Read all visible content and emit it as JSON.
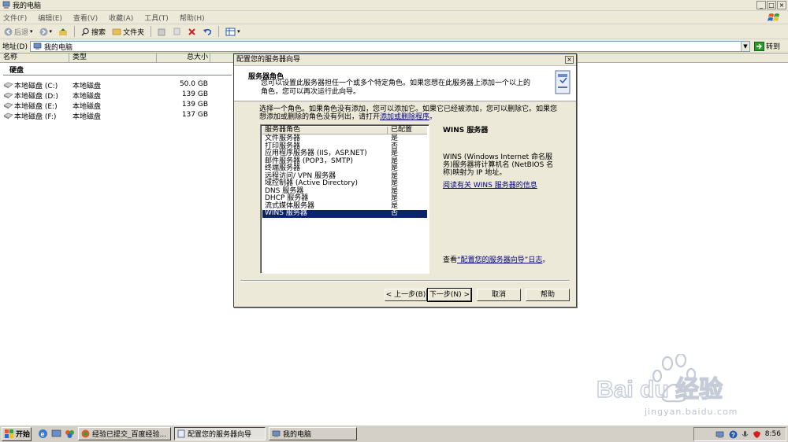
{
  "window": {
    "title": "我的电脑",
    "controls": [
      "_",
      "□",
      "×"
    ]
  },
  "menu": [
    "文件(F)",
    "编辑(E)",
    "查看(V)",
    "收藏(A)",
    "工具(T)",
    "帮助(H)"
  ],
  "toolbar": {
    "back": "后退",
    "search": "搜索",
    "folders": "文件夹"
  },
  "address": {
    "label": "地址(D)",
    "value": "我的电脑",
    "go": "转到"
  },
  "columns": {
    "name": "名称",
    "type": "类型",
    "size": "总大小"
  },
  "group_label": "硬盘",
  "drives": [
    {
      "name": "本地磁盘 (C:)",
      "type": "本地磁盘",
      "size": "50.0 GB"
    },
    {
      "name": "本地磁盘 (D:)",
      "type": "本地磁盘",
      "size": "139 GB"
    },
    {
      "name": "本地磁盘 (E:)",
      "type": "本地磁盘",
      "size": "139 GB"
    },
    {
      "name": "本地磁盘 (F:)",
      "type": "本地磁盘",
      "size": "137 GB"
    }
  ],
  "wizard": {
    "title": "配置您的服务器向导",
    "header_title": "服务器角色",
    "header_sub": "您可以设置此服务器担任一个或多个特定角色。如果您想在此服务器上添加一个以上的角色，您可以再次运行此向导。",
    "intro_a": "选择一个角色。如果角色没有添加，您可以添加它。如果它已经被添加，您可以删除它。如果您想添加或删除的角色没有列出，请打开",
    "intro_link": "添加或删除程序",
    "intro_end": "。",
    "list_headers": {
      "role": "服务器角色",
      "configured": "已配置"
    },
    "roles": [
      {
        "name": "文件服务器",
        "configured": "是"
      },
      {
        "name": "打印服务器",
        "configured": "否"
      },
      {
        "name": "应用程序服务器 (IIS，ASP.NET)",
        "configured": "是"
      },
      {
        "name": "邮件服务器 (POP3，SMTP)",
        "configured": "是"
      },
      {
        "name": "终端服务器",
        "configured": "是"
      },
      {
        "name": "远程访问/ VPN 服务器",
        "configured": "是"
      },
      {
        "name": "域控制器 (Active Directory)",
        "configured": "是"
      },
      {
        "name": "DNS 服务器",
        "configured": "是"
      },
      {
        "name": "DHCP 服务器",
        "configured": "是"
      },
      {
        "name": "流式媒体服务器",
        "configured": "是"
      },
      {
        "name": "WINS 服务器",
        "configured": "否"
      }
    ],
    "selected_index": 10,
    "detail_title": "WINS 服务器",
    "detail_desc": "WINS (Windows Internet 命名服务)服务器将计算机名 (NetBIOS 名称)映射为 IP 地址。",
    "detail_link": "阅读有关 WINS 服务器的信息",
    "log_prefix": "查看",
    "log_link": "“配置您的服务器向导”日志",
    "log_suffix": "。",
    "buttons": {
      "back": "< 上一步(B)",
      "next": "下一步(N) >",
      "cancel": "取消",
      "help": "帮助"
    }
  },
  "taskbar": {
    "start": "开始",
    "tasks": [
      "经验已提交_百度经验...",
      "配置您的服务器向导",
      "我的电脑"
    ],
    "clock": "8:56"
  },
  "watermark": {
    "logo_text": "Bai du 经验",
    "url": "jingyan.baidu.com"
  }
}
